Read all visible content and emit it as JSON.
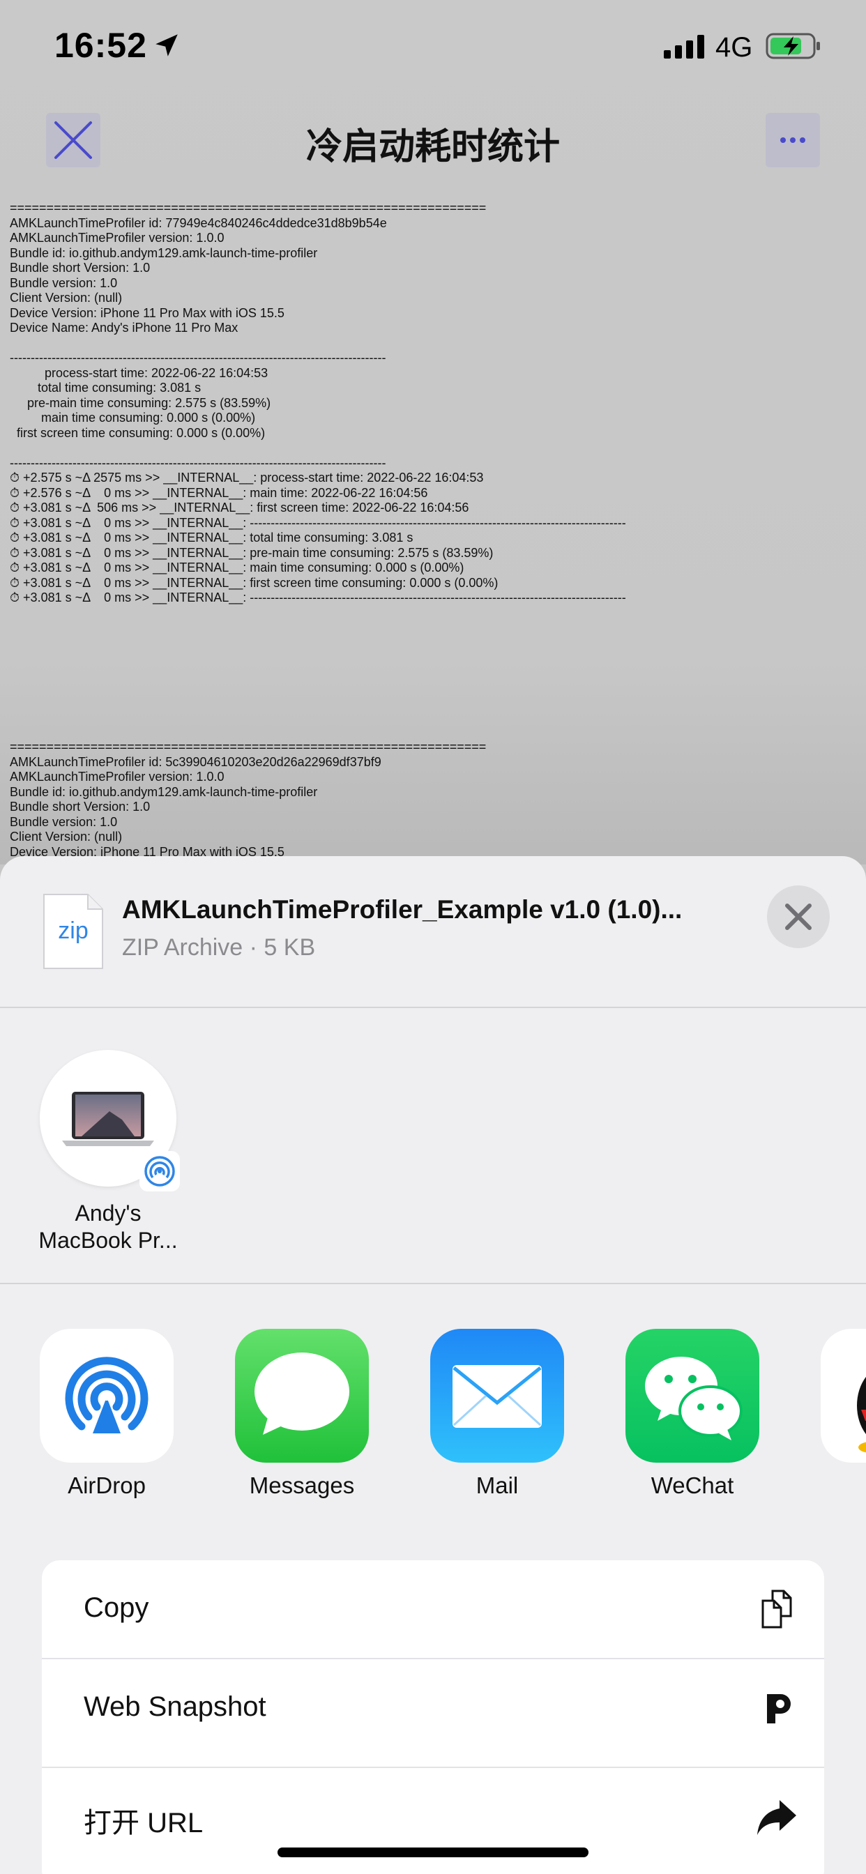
{
  "status_bar": {
    "time": "16:52",
    "network": "4G",
    "icons": [
      "location-arrow-icon",
      "signal-bars-icon",
      "battery-charging-icon"
    ]
  },
  "nav": {
    "title": "冷启动耗时统计",
    "close_icon": "close-icon",
    "more_icon": "more-icon",
    "accent": "#4a4acb"
  },
  "log": {
    "block1": "=================================================================\nAMKLaunchTimeProfiler id: 77949e4c840246c4ddedce31d8b9b54e\nAMKLaunchTimeProfiler version: 1.0.0\nBundle id: io.github.andym129.amk-launch-time-profiler\nBundle short Version: 1.0\nBundle version: 1.0\nClient Version: (null)\nDevice Version: iPhone 11 Pro Max with iOS 15.5\nDevice Name: Andy's iPhone 11 Pro Max\n\n------------------------------------------------------------------------------------------\n          process-start time: 2022-06-22 16:04:53\n        total time consuming: 3.081 s\n     pre-main time consuming: 2.575 s (83.59%)\n         main time consuming: 0.000 s (0.00%)\n  first screen time consuming: 0.000 s (0.00%)\n\n------------------------------------------------------------------------------------------\n⏱ +2.575 s ~Δ 2575 ms >> __INTERNAL__: process-start time: 2022-06-22 16:04:53\n⏱ +2.576 s ~Δ    0 ms >> __INTERNAL__: main time: 2022-06-22 16:04:56\n⏱ +3.081 s ~Δ  506 ms >> __INTERNAL__: first screen time: 2022-06-22 16:04:56\n⏱ +3.081 s ~Δ    0 ms >> __INTERNAL__: ------------------------------------------------------------------------------------------\n⏱ +3.081 s ~Δ    0 ms >> __INTERNAL__: total time consuming: 3.081 s\n⏱ +3.081 s ~Δ    0 ms >> __INTERNAL__: pre-main time consuming: 2.575 s (83.59%)\n⏱ +3.081 s ~Δ    0 ms >> __INTERNAL__: main time consuming: 0.000 s (0.00%)\n⏱ +3.081 s ~Δ    0 ms >> __INTERNAL__: first screen time consuming: 0.000 s (0.00%)\n⏱ +3.081 s ~Δ    0 ms >> __INTERNAL__: ------------------------------------------------------------------------------------------",
    "block2": "=================================================================\nAMKLaunchTimeProfiler id: 5c39904610203e20d26a22969df37bf9\nAMKLaunchTimeProfiler version: 1.0.0\nBundle id: io.github.andym129.amk-launch-time-profiler\nBundle short Version: 1.0\nBundle version: 1.0\nClient Version: (null)\nDevice Version: iPhone 11 Pro Max with iOS 15.5"
  },
  "share": {
    "file_icon_label": "zip",
    "file_name": "AMKLaunchTimeProfiler_Example v1.0 (1.0)...",
    "file_meta": "ZIP Archive · 5 KB",
    "close_icon": "close-icon",
    "airdrop_device": {
      "label": "Andy's MacBook Pr...",
      "icon": "macbook-icon",
      "badge_icon": "airdrop-badge-icon"
    },
    "apps": [
      {
        "label": "AirDrop",
        "icon": "airdrop-icon"
      },
      {
        "label": "Messages",
        "icon": "messages-icon"
      },
      {
        "label": "Mail",
        "icon": "mail-icon"
      },
      {
        "label": "WeChat",
        "icon": "wechat-icon"
      },
      {
        "label": "",
        "icon": "qq-icon"
      }
    ],
    "actions": [
      {
        "label": "Copy",
        "icon": "copy-icon"
      },
      {
        "label": "Web Snapshot",
        "icon": "web-snapshot-icon"
      },
      {
        "label": "打开 URL",
        "icon": "share-arrow-icon"
      }
    ]
  }
}
